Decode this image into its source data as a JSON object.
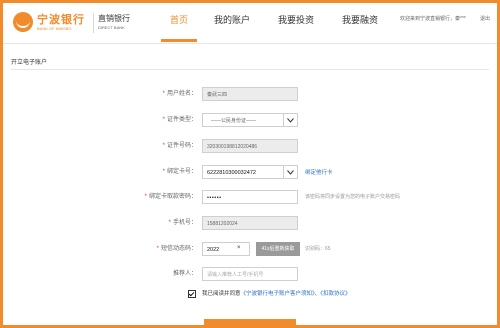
{
  "header": {
    "logo_name": "宁波银行",
    "logo_sub": "BANK OF NINGBO",
    "logo_direct": "直销银行",
    "logo_direct_sub": "DIRECT BANK",
    "nav": [
      {
        "label": "首页",
        "active": true
      },
      {
        "label": "我的账户",
        "active": false
      },
      {
        "label": "我要投资",
        "active": false
      },
      {
        "label": "我要融资",
        "active": false
      }
    ],
    "welcome": "欢迎来到宁波直销银行，秦***",
    "logout": "退出"
  },
  "section": {
    "title": "开立电子账户"
  },
  "form": {
    "name": {
      "label": "用户姓名：",
      "value": "秦武三四"
    },
    "id_type": {
      "label": "证件类型：",
      "value": "——公民身份证——"
    },
    "id_number": {
      "label": "证件号码：",
      "value": "320300198812020486"
    },
    "card_number": {
      "label": "绑定卡号：",
      "value": "6222810300032472",
      "link": "绑定他行卡"
    },
    "card_password": {
      "label": "绑定卡取款密码：",
      "value": "••••••",
      "hint": "该密码将同步设置为您的电子账户交易密码"
    },
    "phone": {
      "label": "手机号：",
      "value": "15881202024"
    },
    "sms_code": {
      "label": "短信动态码：",
      "value": "2022",
      "clear": "×",
      "send_button": "41s后重新获取",
      "hint": "识别码：65"
    },
    "referrer": {
      "label": "推荐人：",
      "placeholder": "请输入推荐人工号/手机号"
    }
  },
  "agreement": {
    "prefix": "我已阅读并同意",
    "link1": "《宁波银行电子账户客户须知》",
    "separator": "、",
    "link2": "《扣款协议》",
    "checked": true
  },
  "colors": {
    "brand": "#f28b2c",
    "link": "#2a6fc9",
    "required": "#e33333"
  }
}
